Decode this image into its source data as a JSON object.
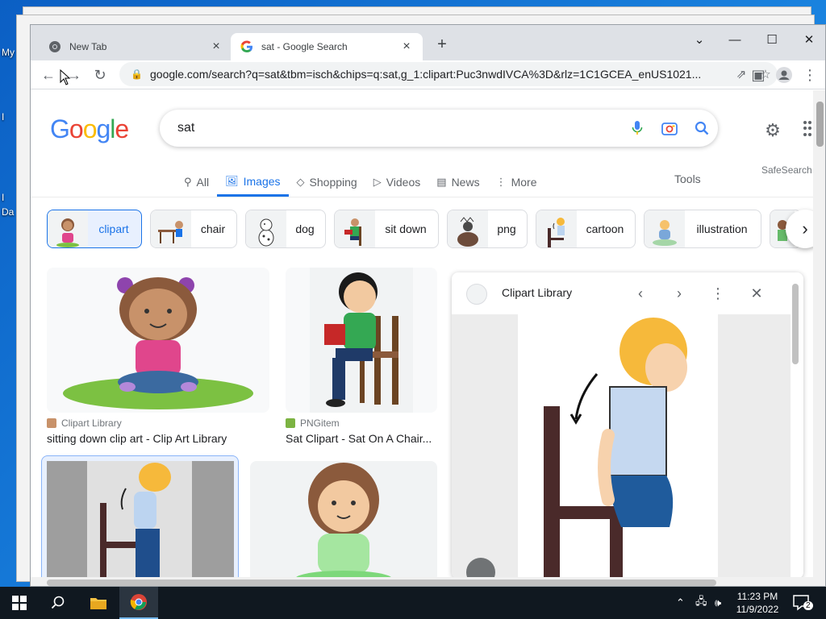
{
  "desktop": {
    "labels": [
      "My",
      "I",
      "I",
      "Da"
    ]
  },
  "browser": {
    "tabs": [
      {
        "label": "New Tab",
        "icon": "chrome-icon",
        "active": false
      },
      {
        "label": "sat - Google Search",
        "icon": "google-g-icon",
        "active": true
      }
    ],
    "url": "google.com/search?q=sat&tbm=isch&chips=q:sat,g_1:clipart:Puc3nwdIVCA%3D&rlz=1C1GCEA_enUS1021..."
  },
  "search": {
    "query": "sat",
    "logo_text": "Google",
    "safesearch": "SafeSearch",
    "tabs": [
      {
        "label": "All",
        "icon": "search-icon",
        "active": false
      },
      {
        "label": "Images",
        "icon": "image-icon",
        "active": true
      },
      {
        "label": "Shopping",
        "icon": "tag-icon",
        "active": false
      },
      {
        "label": "Videos",
        "icon": "play-icon",
        "active": false
      },
      {
        "label": "News",
        "icon": "news-icon",
        "active": false
      },
      {
        "label": "More",
        "icon": "more-vert-icon",
        "active": false
      }
    ],
    "tools": "Tools",
    "chips": [
      {
        "label": "clipart",
        "active": true
      },
      {
        "label": "chair",
        "active": false
      },
      {
        "label": "dog",
        "active": false
      },
      {
        "label": "sit down",
        "active": false
      },
      {
        "label": "png",
        "active": false
      },
      {
        "label": "cartoon",
        "active": false
      },
      {
        "label": "illustration",
        "active": false
      }
    ]
  },
  "results": [
    {
      "source": "Clipart Library",
      "title": "sitting down clip art - Clip Art Library"
    },
    {
      "source": "PNGitem",
      "title": "Sat Clipart - Sat On A Chair..."
    }
  ],
  "panel": {
    "source": "Clipart Library"
  },
  "taskbar": {
    "time": "11:23 PM",
    "date": "11/9/2022",
    "notifications": "2"
  },
  "colors": {
    "accent": "#1a73e8",
    "chip_active_bg": "#e8f0fe"
  }
}
